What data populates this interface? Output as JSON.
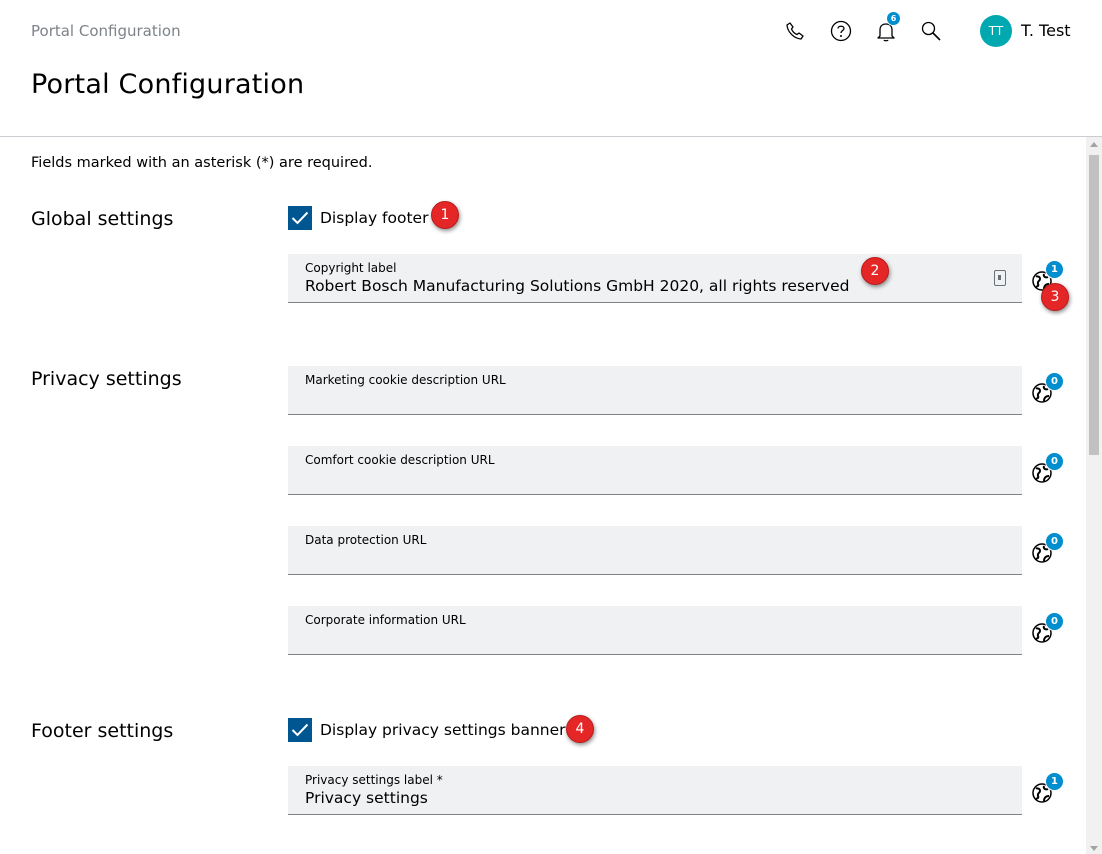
{
  "header": {
    "breadcrumb": "Portal Configuration",
    "title": "Portal Configuration",
    "notification_count": "6",
    "user_initials": "TT",
    "user_name": "T. Test"
  },
  "required_note": "Fields marked with an asterisk (*) are required.",
  "sections": {
    "global": {
      "title": "Global settings",
      "checkbox_label": "Display footer",
      "copyright_field": {
        "label": "Copyright label",
        "value": "Robert Bosch Manufacturing Solutions GmbH 2020, all rights reserved",
        "translation_count": "1"
      }
    },
    "privacy": {
      "title": "Privacy settings",
      "fields": [
        {
          "label": "Marketing cookie description URL",
          "value": "",
          "translation_count": "0"
        },
        {
          "label": "Comfort cookie description URL",
          "value": "",
          "translation_count": "0"
        },
        {
          "label": "Data protection URL",
          "value": "",
          "translation_count": "0"
        },
        {
          "label": "Corporate information URL",
          "value": "",
          "translation_count": "0"
        }
      ]
    },
    "footer": {
      "title": "Footer settings",
      "checkbox_label": "Display privacy settings banner",
      "privacy_label_field": {
        "label": "Privacy settings label *",
        "value": "Privacy settings",
        "translation_count": "1"
      }
    }
  },
  "markers": [
    "1",
    "2",
    "3",
    "4"
  ],
  "colors": {
    "accent": "#005691",
    "badge": "#008ecf",
    "avatar": "#00a8b0",
    "marker": "#e42626",
    "field_bg": "#eff1f2"
  }
}
